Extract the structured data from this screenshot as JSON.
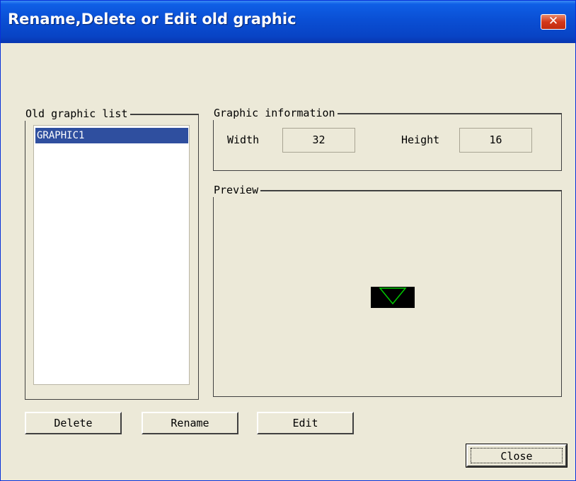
{
  "window": {
    "title": "Rename,Delete or Edit old graphic",
    "close_glyph": "✕"
  },
  "old_graphic_list": {
    "legend": "Old graphic list",
    "items": [
      "GRAPHIC1"
    ],
    "selected": "GRAPHIC1"
  },
  "graphic_information": {
    "legend": "Graphic information",
    "width_label": "Width",
    "width_value": "32",
    "height_label": "Height",
    "height_value": "16"
  },
  "preview": {
    "legend": "Preview",
    "shape_icon": "downward-triangle-icon",
    "shape_color": "#00cc00",
    "background_color": "#000000"
  },
  "buttons": {
    "delete": "Delete",
    "rename": "Rename",
    "edit": "Edit",
    "close": "Close"
  },
  "colors": {
    "selection": "#2f4f9f",
    "titlebar": "#0a4fd4",
    "dialog_bg": "#ece9d8"
  }
}
